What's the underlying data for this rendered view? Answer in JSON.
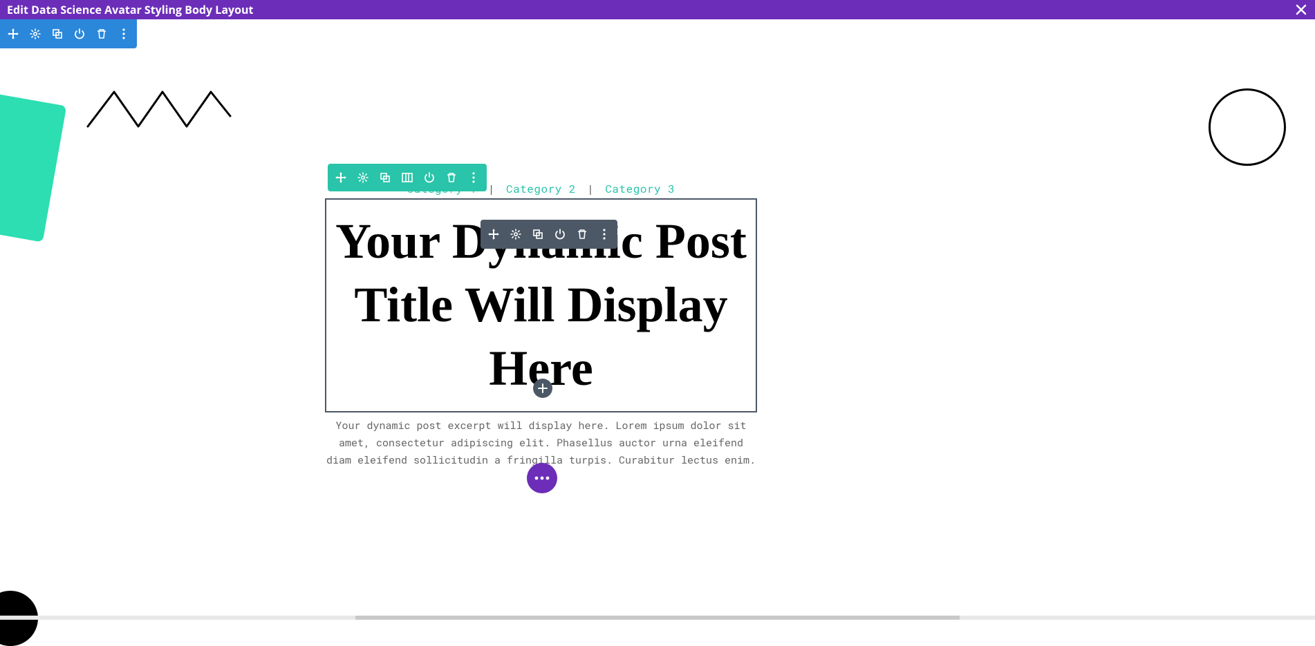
{
  "topbar": {
    "title": "Edit Data Science Avatar Styling Body Layout"
  },
  "categories": {
    "items": [
      "Category 1",
      "Category 2",
      "Category 3"
    ],
    "separator": "|"
  },
  "post": {
    "title": "Your Dynamic Post Title Will Display Here",
    "excerpt": "Your dynamic post excerpt will display here. Lorem ipsum dolor sit amet, consectetur adipiscing elit. Phasellus auctor urna eleifend diam eleifend sollicitudin a fringilla turpis. Curabitur lectus enim."
  },
  "icons": {
    "close": "×",
    "plus": "+",
    "dots": "⋯"
  }
}
